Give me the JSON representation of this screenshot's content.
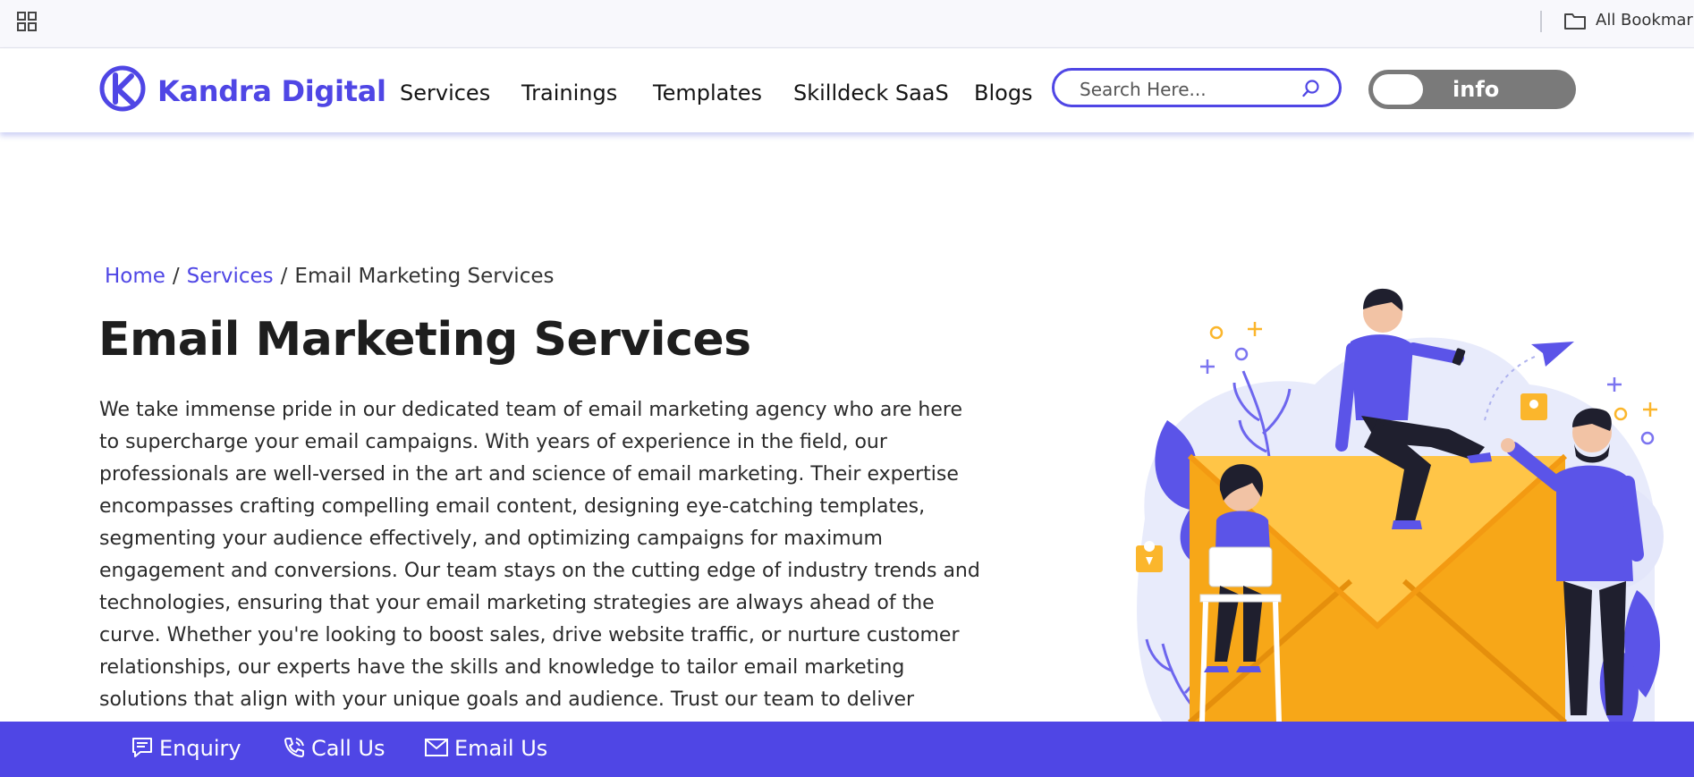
{
  "bookmarks_bar": {
    "folder_label": "All Bookmarks"
  },
  "header": {
    "logo_text": "Kandra Digital",
    "nav": [
      "Services",
      "Trainings",
      "Templates",
      "Skilldeck SaaS",
      "Blogs"
    ],
    "search_placeholder": "Search Here...",
    "toggle_label": "info"
  },
  "breadcrumb": {
    "home": "Home",
    "services": "Services",
    "separator": "/",
    "current": "Email Marketing Services"
  },
  "main": {
    "title": "Email Marketing Services",
    "intro": "We take immense pride in our dedicated team of email marketing agency who are here to supercharge your email campaigns. With years of experience in the field, our professionals are well-versed in the art and science of email marketing. Their expertise encompasses crafting compelling email content, designing eye-catching templates, segmenting your audience effectively, and optimizing campaigns for maximum engagement and conversions. Our team stays on the cutting edge of industry trends and technologies, ensuring that your email marketing strategies are always ahead of the curve. Whether you're looking to boost sales, drive website traffic, or nurture customer relationships, our experts have the skills and knowledge to tailor email marketing solutions that align with your unique goals and audience. Trust our team to deliver measurable results and take your email marketing to"
  },
  "contact_bar": {
    "enquiry": "Enquiry",
    "call": "Call Us",
    "email": "Email Us"
  },
  "colors": {
    "brand": "#4f46e5",
    "toggle_bg": "#7a7a7a",
    "envelope": "#fbb62c",
    "envelope_front": "#ffc547"
  },
  "icons": {
    "apps": "apps-grid-icon",
    "bookmark_folder": "folder-icon",
    "search": "search-icon",
    "enquiry": "message-icon",
    "call": "phone-icon",
    "email": "mail-icon"
  }
}
